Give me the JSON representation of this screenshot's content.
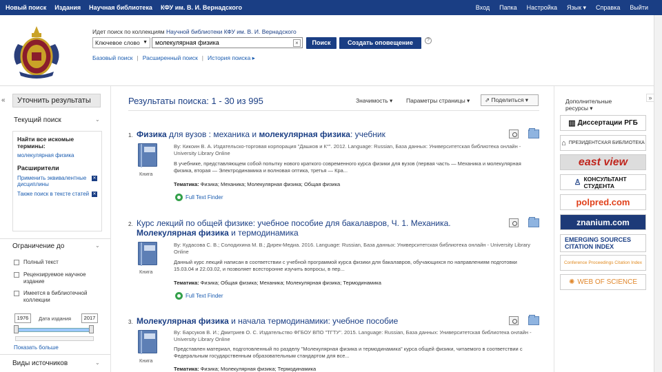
{
  "topnav": {
    "left": [
      "Новый поиск",
      "Издания",
      "Научная библиотека",
      "КФУ им. В. И. Вернадского"
    ],
    "right": [
      "Вход",
      "Папка",
      "Настройка",
      "Язык ▾",
      "Справка",
      "Выйти"
    ]
  },
  "header": {
    "search_label_prefix": "Идет поиск по коллекциям ",
    "search_label_hl": "Научной библиотеки КФУ им. В. И. Вернадского",
    "field_select": "Ключевое слово",
    "query": "молекулярная физика",
    "clear": "×",
    "search_btn": "Поиск",
    "alert_btn": "Создать оповещение",
    "help": "?",
    "links": [
      "Базовый поиск",
      "Расширенный поиск",
      "История поиска ▸"
    ]
  },
  "sidebar": {
    "refine": "Уточнить результаты",
    "current_search": "Текущий поиск",
    "find_all": "Найти все искомые термины:",
    "term": "молекулярная физика",
    "expanders": "Расширители",
    "exp1": "Применить эквивалентные дисциплины",
    "exp2": "Также поиск в тексте статей",
    "limit_to": "Ограничение до",
    "cb1": "Полный текст",
    "cb2": "Рецензируемое научное издание",
    "cb3": "Имеется в библиотечной коллекции",
    "date_from": "1976",
    "date_label": "Дата издания",
    "date_to": "2017",
    "show_more": "Показать больше",
    "sources": "Виды источников"
  },
  "results": {
    "title": "Результаты поиска: 1 - 30 из 995",
    "sort": "Значимость ▾",
    "page_options": "Параметры страницы ▾",
    "share": "Поделиться ▾",
    "items": [
      {
        "num": "1.",
        "title_hl1": "Физика",
        "title_p1": " для вузов : механика и ",
        "title_hl2": "молекулярная физика",
        "title_p2": ": учебник",
        "type": "Книга",
        "meta": "By: Кикоин В. А. Издательско-торговая корпорация \"Дашков и К°\". 2012. Language: Russian, База данных: Университетская библиотека онлайн - University Library Online",
        "desc": "В учебнике, представляющем собой попытку нового краткого современного курса физики для вузов (первая часть — Механика и молекулярная физика, вторая — Электродинамика и волновая оптика, третья — Кра...",
        "subj_label": "Тематика:",
        "subj": "Физика; Механика; Молекулярная физика; Общая физика",
        "fulltext": "Full Text Finder"
      },
      {
        "num": "2.",
        "title_hl1": "Курс лекций по общей физике: учебное пособие для бакалавров, Ч. 1. Механика.",
        "title_p1": "",
        "title_hl2": "Молекулярная физика",
        "title_p2": " и термодинамика",
        "type": "Книга",
        "meta": "By: Кудасова С. В.; Солодихина М. В.; Дирек-Медиа. 2016. Language: Russian, База данных: Университетская библиотека онлайн - University Library Online",
        "desc": "Данный курс лекций написан в соответствии с учебной программой курса физики для бакалавров, обучающихся по направлениям подготовки 15.03.04 и 22.03.02, и позволяет всесторонне изучить вопросы, в пер...",
        "subj_label": "Тематика:",
        "subj": "Физика; Общая физика; Механика; Молекулярная физика; Термодинамика",
        "fulltext": "Full Text Finder"
      },
      {
        "num": "3.",
        "title_hl1": "Молекулярная физика",
        "title_p1": "",
        "title_hl2": "",
        "title_p2": " и начала термодинамики: учебное пособие",
        "type": "Книга",
        "meta": "By: Барсуков В. И.; Дмитриев О. С. Издательство ФГБОУ ВПО \"ТГТУ\". 2015. Language: Russian, База данных: Университетская библиотека онлайн - University Library Online",
        "desc": "Представлен материал, подготовленный по разделу \"Молекулярная физика и термодинамика\" курса общей физики, читаемого в соответствии с Федеральным государственным образовательным стандартом для все...",
        "subj_label": "Тематика:",
        "subj": "Физика; Молекулярная физика; Термодинамика",
        "fulltext": "Full Text Finder"
      }
    ]
  },
  "resources": {
    "title": "Дополнительные ресурсы ▾",
    "logos": [
      "Диссертации РГБ",
      "ПРЕЗИДЕНТСКАЯ БИБЛИОТЕКА",
      "east view",
      "КОНСУЛЬТАНТ СТУДЕНТА",
      "polpred.com",
      "znanium.com",
      "EMERGING SOURCES CITATION INDEX",
      "Conference Proceedings Citation Index",
      "WEB OF SCIENCE"
    ]
  },
  "colors": {
    "brand": "#1a3e84",
    "link": "#1a5cb0"
  }
}
